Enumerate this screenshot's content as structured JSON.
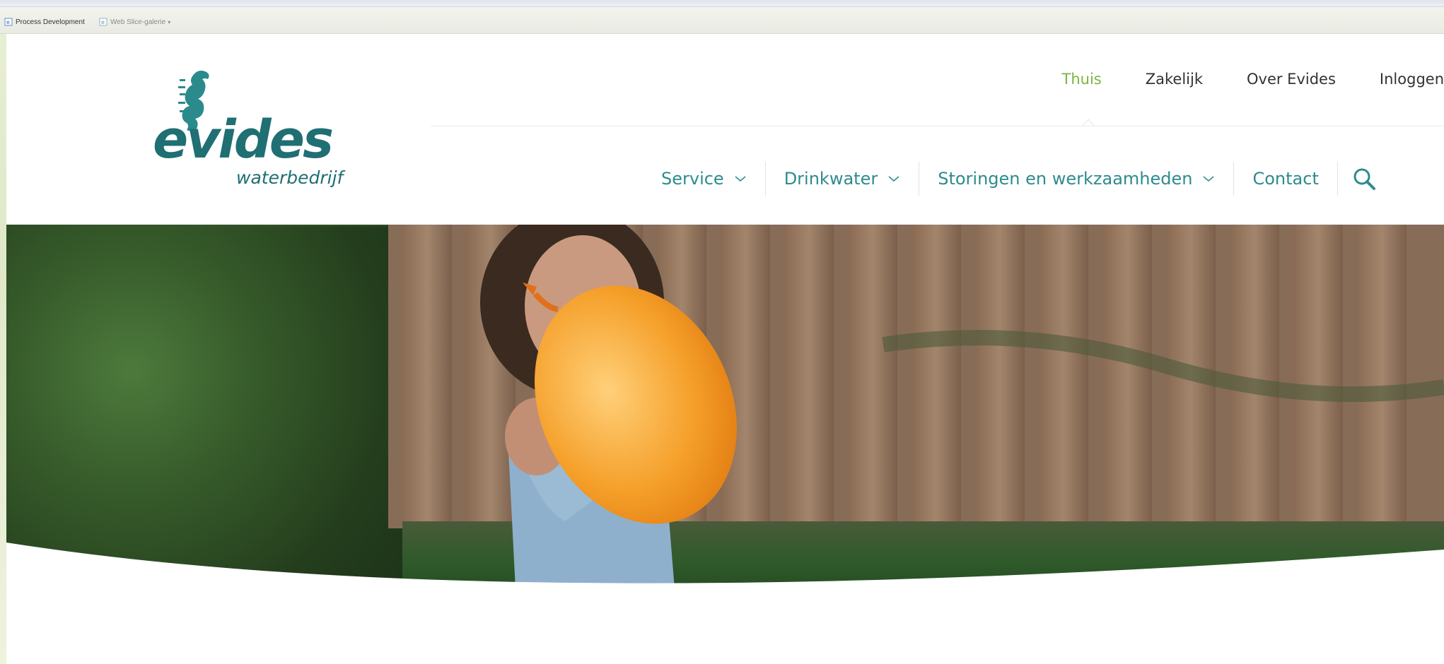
{
  "favorites_bar": {
    "items": [
      {
        "label": "Process Development",
        "icon": "ie-page-icon"
      },
      {
        "label": "Web Slice-galerie",
        "icon": "ie-page-icon",
        "has_dropdown": true
      }
    ]
  },
  "logo": {
    "brand": "evides",
    "tagline": "waterbedrijf",
    "icon": "seahorse-icon"
  },
  "top_nav": {
    "items": [
      {
        "label": "Thuis",
        "active": true
      },
      {
        "label": "Zakelijk"
      },
      {
        "label": "Over Evides"
      },
      {
        "label": "Inloggen"
      }
    ]
  },
  "main_nav": {
    "items": [
      {
        "label": "Service",
        "has_dropdown": true
      },
      {
        "label": "Drinkwater",
        "has_dropdown": true
      },
      {
        "label": "Storingen en werkzaamheden",
        "has_dropdown": true
      },
      {
        "label": "Contact",
        "has_dropdown": false
      }
    ],
    "search_icon": "search-icon"
  },
  "colors": {
    "accent_green": "#7cb342",
    "teal": "#2e8b8d",
    "logo_teal": "#1f6f73",
    "balloon_orange": "#f5a02a"
  }
}
